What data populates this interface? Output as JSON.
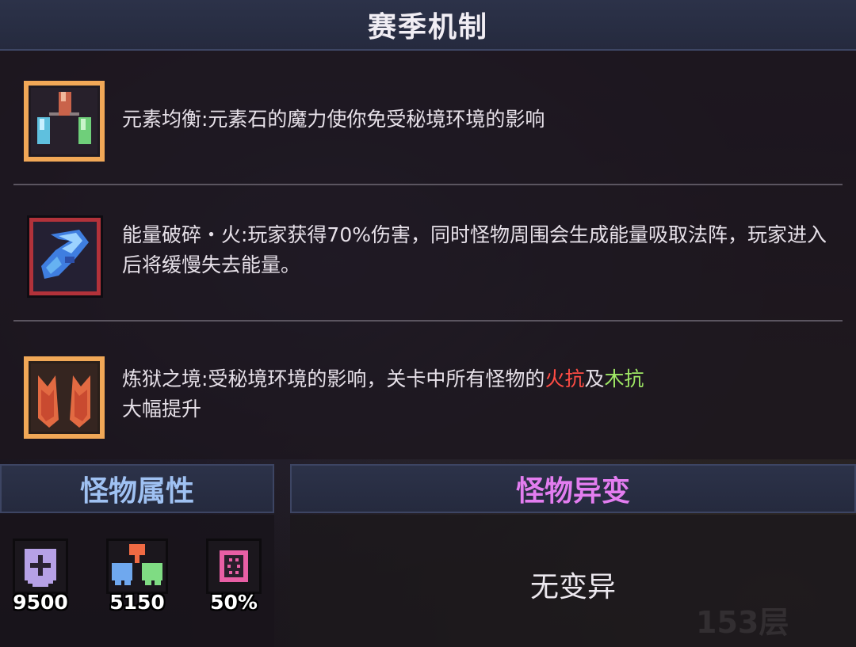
{
  "header": {
    "title": "赛季机制"
  },
  "mechanics": [
    {
      "icon": "element-stones-icon",
      "text_before": "元素均衡:元素石的魔力使你免受秘境环境的影响",
      "hl1": "",
      "mid": "",
      "hl2": "",
      "text_after": ""
    },
    {
      "icon": "energy-shatter-fire-icon",
      "text_before": "能量破碎・火:玩家获得70%伤害，同时怪物周围会生成能量吸取法阵，玩家进入后将缓慢失去能量。",
      "hl1": "",
      "mid": "",
      "hl2": "",
      "text_after": ""
    },
    {
      "icon": "purgatory-realm-icon",
      "text_before": "炼狱之境:受秘境环境的影响，关卡中所有怪物的",
      "hl1": "火抗",
      "mid": "及",
      "hl2": "木抗",
      "text_after": "大幅提升"
    }
  ],
  "highlight_colors": {
    "fire": "#ff4c44",
    "wood": "#9fe865"
  },
  "monster_attributes": {
    "title": "怪物属性",
    "stats": [
      {
        "icon": "health-shield-icon",
        "value": "9500"
      },
      {
        "icon": "element-tree-icon",
        "value": "5150"
      },
      {
        "icon": "gear-burst-icon",
        "value": "50%"
      }
    ]
  },
  "monster_mutation": {
    "title": "怪物异变",
    "value": "无变异"
  },
  "floor_label": "153层"
}
